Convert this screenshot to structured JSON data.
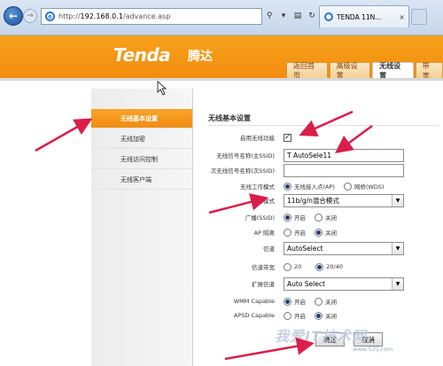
{
  "browser": {
    "url_prefix": "http://",
    "url_host": "192.168.0.1",
    "url_path": "/advance.asp",
    "tab_title": "TENDA 11N..."
  },
  "header": {
    "logo_text": "Tenda",
    "logo_cn": "腾达",
    "nav": [
      "返回首页",
      "高级设置",
      "无线设置",
      "带宽"
    ]
  },
  "sidebar": {
    "items": [
      "无线基本设置",
      "无线加密",
      "无线访问控制",
      "无线客户端"
    ]
  },
  "form": {
    "section_title": "无线基本设置",
    "enable_label": "启用无线功能",
    "ssid1_label": "无线信号名称(主SSID)",
    "ssid1_value": "T AutoSele11",
    "ssid2_label": "次无线信号名称(次SSID)",
    "ssid2_value": "",
    "mode_label": "无线工作模式",
    "mode_ap": "无线接入点(AP)",
    "mode_wds": "网桥(WDS)",
    "netmode_label": "网络模式",
    "netmode_value": "11b/g/n混合模式",
    "broadcast_label": "广播(SSID)",
    "on": "开启",
    "off": "关闭",
    "isolation_label": "AP 隔离",
    "channel_label": "信道",
    "channel_value": "AutoSelect",
    "bandwidth_label": "信道带宽",
    "bw_20": "20",
    "bw_2040": "20/40",
    "ext_channel_label": "扩展信道",
    "ext_channel_value": "Auto Select",
    "wmm_label": "WMM Capable",
    "apsd_label": "APSD Capable",
    "ok_button": "确定",
    "cancel_button": "取消"
  },
  "watermark": {
    "text": "我爱IT技术网",
    "sub": "www.52ij.com"
  },
  "colors": {
    "brand_orange": "#f39112",
    "annotation": "#d91e4a"
  }
}
